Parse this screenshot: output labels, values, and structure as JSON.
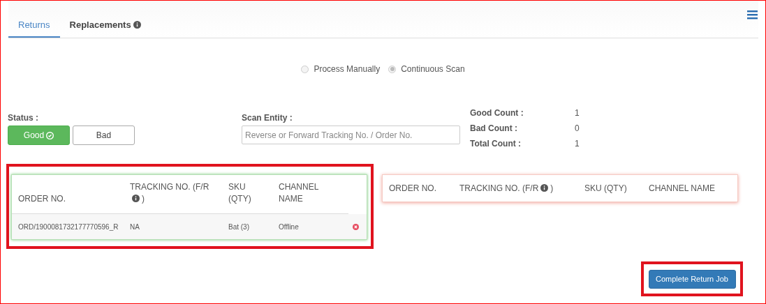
{
  "tabs": [
    {
      "label": "Returns",
      "selected": true,
      "info": false
    },
    {
      "label": "Replacements",
      "selected": false,
      "info": true
    }
  ],
  "mode_options": [
    {
      "label": "Process Manually",
      "selected": false
    },
    {
      "label": "Continuous Scan",
      "selected": true
    }
  ],
  "status": {
    "label": "Status :",
    "options": [
      {
        "label": "Good",
        "selected": true
      },
      {
        "label": "Bad",
        "selected": false
      }
    ]
  },
  "scan_entity": {
    "label": "Scan Entity :",
    "placeholder": "Reverse or Forward Tracking No. / Order No."
  },
  "counts": [
    {
      "label": "Good Count :",
      "value": "1"
    },
    {
      "label": "Bad Count :",
      "value": "0"
    },
    {
      "label": "Total Count :",
      "value": "1"
    }
  ],
  "good_table": {
    "columns": [
      {
        "label": "ORDER NO."
      },
      {
        "label": "TRACKING NO. (F/R",
        "suffix": ")",
        "info": true
      },
      {
        "label": "SKU (QTY)"
      },
      {
        "label": "CHANNEL NAME"
      }
    ],
    "rows": [
      {
        "order_no": "ORD/1900081732177770596_R",
        "tracking_no": "NA",
        "sku_qty": "Bat (3)",
        "channel_name": "Offline"
      }
    ]
  },
  "bad_table": {
    "columns": [
      {
        "label": "ORDER NO."
      },
      {
        "label": "TRACKING NO. (F/R",
        "suffix": ")",
        "info": true
      },
      {
        "label": "SKU (QTY)"
      },
      {
        "label": "CHANNEL NAME"
      }
    ]
  },
  "complete_button": "Complete Return Job"
}
